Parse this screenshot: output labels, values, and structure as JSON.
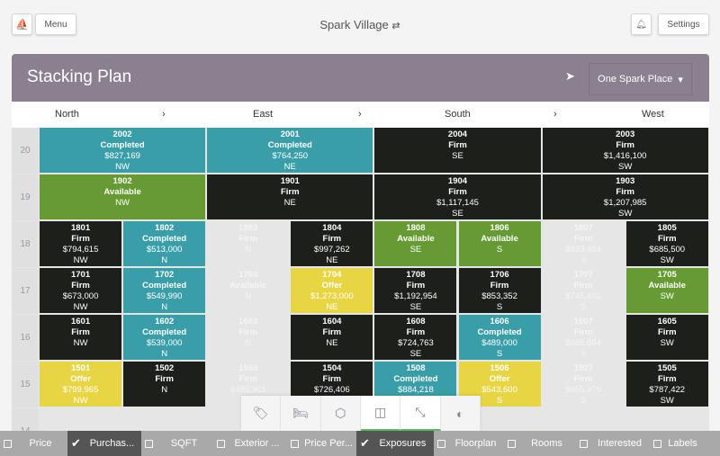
{
  "header": {
    "logo_icon": "sail-logo-icon",
    "menu": "Menu",
    "title": "Spark Village",
    "shuffle_icon": "shuffle-icon",
    "bell_icon": "bell-icon",
    "settings": "Settings"
  },
  "panel": {
    "title": "Stacking Plan",
    "send_icon": "paper-plane-icon",
    "building": "One Spark Place"
  },
  "directions": [
    "North",
    "East",
    "South",
    "West"
  ],
  "colors": {
    "Completed": "#3a9ea8",
    "Available": "#669b33",
    "Firm": "#1c1f1a",
    "Offer": "#e8d544",
    "dimmed": "#e6e6e6"
  },
  "floors": [
    {
      "floor": "20",
      "units": [
        {
          "n": "2002",
          "s": "Completed",
          "p": "$827,169",
          "e": "NW",
          "span": 2
        },
        {
          "n": "2001",
          "s": "Completed",
          "p": "$764,250",
          "e": "NE",
          "span": 2
        },
        {
          "n": "2004",
          "s": "Firm",
          "p": "",
          "e": "SE",
          "span": 2
        },
        {
          "n": "2003",
          "s": "Firm",
          "p": "$1,416,100",
          "e": "SW",
          "span": 2
        }
      ]
    },
    {
      "floor": "19",
      "units": [
        {
          "n": "1902",
          "s": "Available",
          "p": "",
          "e": "NW",
          "span": 2
        },
        {
          "n": "1901",
          "s": "Firm",
          "p": "",
          "e": "NE",
          "span": 2
        },
        {
          "n": "1904",
          "s": "Firm",
          "p": "$1,117,145",
          "e": "SE",
          "span": 2
        },
        {
          "n": "1903",
          "s": "Firm",
          "p": "$1,207,985",
          "e": "SW",
          "span": 2
        }
      ]
    },
    {
      "floor": "18",
      "units": [
        {
          "n": "1801",
          "s": "Firm",
          "p": "$794,615",
          "e": "NW",
          "span": 1
        },
        {
          "n": "1802",
          "s": "Completed",
          "p": "$513,000",
          "e": "N",
          "span": 1
        },
        {
          "n": "1803",
          "s": "Firm",
          "p": "",
          "e": "N",
          "span": 1,
          "dim": true
        },
        {
          "n": "1804",
          "s": "Firm",
          "p": "$997,262",
          "e": "NE",
          "span": 1
        },
        {
          "n": "1808",
          "s": "Available",
          "p": "",
          "e": "SE",
          "span": 1
        },
        {
          "n": "1806",
          "s": "Available",
          "p": "",
          "e": "S",
          "span": 1
        },
        {
          "n": "1807",
          "s": "Firm",
          "p": "$833,414",
          "e": "S",
          "span": 1,
          "dim": true
        },
        {
          "n": "1805",
          "s": "Firm",
          "p": "$685,500",
          "e": "SW",
          "span": 1
        }
      ]
    },
    {
      "floor": "17",
      "units": [
        {
          "n": "1701",
          "s": "Firm",
          "p": "$673,000",
          "e": "NW",
          "span": 1
        },
        {
          "n": "1702",
          "s": "Completed",
          "p": "$549,990",
          "e": "N",
          "span": 1
        },
        {
          "n": "1703",
          "s": "Available",
          "p": "",
          "e": "N",
          "span": 1,
          "dim": true
        },
        {
          "n": "1704",
          "s": "Offer",
          "p": "$1,273,000",
          "e": "NE",
          "span": 1
        },
        {
          "n": "1708",
          "s": "Firm",
          "p": "$1,192,954",
          "e": "SE",
          "span": 1
        },
        {
          "n": "1706",
          "s": "Firm",
          "p": "$853,352",
          "e": "S",
          "span": 1
        },
        {
          "n": "1707",
          "s": "Firm",
          "p": "$745,401",
          "e": "S",
          "span": 1,
          "dim": true
        },
        {
          "n": "1705",
          "s": "Available",
          "p": "",
          "e": "SW",
          "span": 1
        }
      ]
    },
    {
      "floor": "16",
      "units": [
        {
          "n": "1601",
          "s": "Firm",
          "p": "",
          "e": "NW",
          "span": 1
        },
        {
          "n": "1602",
          "s": "Completed",
          "p": "$539,000",
          "e": "N",
          "span": 1
        },
        {
          "n": "1603",
          "s": "Firm",
          "p": "",
          "e": "N",
          "span": 1,
          "dim": true
        },
        {
          "n": "1604",
          "s": "Firm",
          "p": "",
          "e": "NE",
          "span": 1
        },
        {
          "n": "1608",
          "s": "Firm",
          "p": "$724,763",
          "e": "SE",
          "span": 1
        },
        {
          "n": "1606",
          "s": "Completed",
          "p": "$489,000",
          "e": "S",
          "span": 1
        },
        {
          "n": "1607",
          "s": "Firm",
          "p": "$452,894",
          "e": "S",
          "span": 1,
          "dim": true
        },
        {
          "n": "1605",
          "s": "Firm",
          "p": "",
          "e": "SW",
          "span": 1
        }
      ]
    },
    {
      "floor": "15",
      "units": [
        {
          "n": "1501",
          "s": "Offer",
          "p": "$799,965",
          "e": "NW",
          "span": 1
        },
        {
          "n": "1502",
          "s": "Firm",
          "p": "",
          "e": "N",
          "span": 1
        },
        {
          "n": "1503",
          "s": "Firm",
          "p": "$485,901",
          "e": "",
          "span": 1,
          "dim": true
        },
        {
          "n": "1504",
          "s": "Firm",
          "p": "$726,406",
          "e": "",
          "span": 1
        },
        {
          "n": "1508",
          "s": "Completed",
          "p": "$884,218",
          "e": "",
          "span": 1
        },
        {
          "n": "1506",
          "s": "Offer",
          "p": "$543,600",
          "e": "S",
          "span": 1
        },
        {
          "n": "1507",
          "s": "Firm",
          "p": "$655,970",
          "e": "S",
          "span": 1,
          "dim": true
        },
        {
          "n": "1505",
          "s": "Firm",
          "p": "$787,422",
          "e": "SW",
          "span": 1
        }
      ]
    },
    {
      "floor": "14",
      "units": []
    }
  ],
  "tools": [
    {
      "icon": "tag-icon",
      "ch": "🏷"
    },
    {
      "icon": "bed-icon",
      "ch": "🛏"
    },
    {
      "icon": "cube-icon",
      "ch": "⬡"
    },
    {
      "icon": "split-view-icon",
      "ch": "◫",
      "on": true
    },
    {
      "icon": "compress-icon",
      "ch": "⤡",
      "on": true
    },
    {
      "icon": "contrast-icon",
      "ch": "◐"
    }
  ],
  "filters": [
    {
      "label": "Price",
      "checked": false
    },
    {
      "label": "Purchas...",
      "checked": true
    },
    {
      "label": "SQFT",
      "checked": false
    },
    {
      "label": "Exterior ...",
      "checked": false
    },
    {
      "label": "Price Per...",
      "checked": false
    },
    {
      "label": "Exposures",
      "checked": true
    },
    {
      "label": "Floorplan",
      "checked": false
    },
    {
      "label": "Rooms",
      "checked": false
    },
    {
      "label": "Interested",
      "checked": false
    },
    {
      "label": "Labels",
      "checked": false
    }
  ]
}
